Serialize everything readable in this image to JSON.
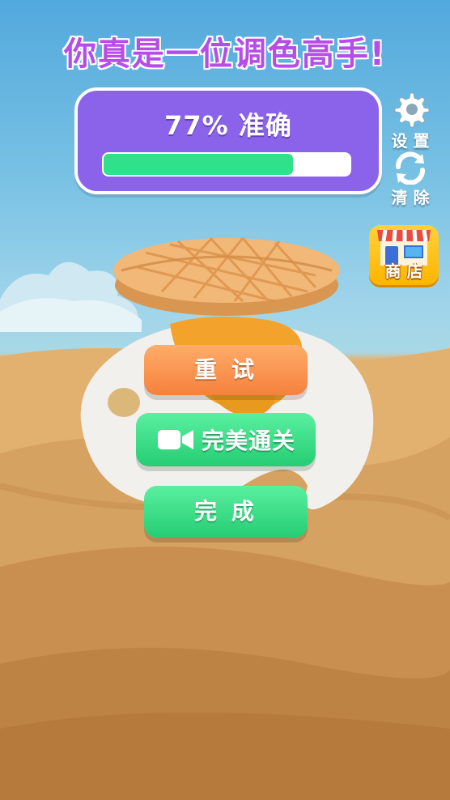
{
  "title": "你真是一位调色高手!",
  "accuracy": {
    "label": "77% 准确",
    "value": 0.77
  },
  "sidebar": {
    "settings": "设 置",
    "clear": "清 除",
    "shop": "商 店"
  },
  "buttons": {
    "retry": "重 试",
    "perfect": "完美通关",
    "done": "完 成"
  },
  "colors": {
    "title": "#b64de6",
    "panel": "#8a63ea",
    "progress": "#2fe18a",
    "retry": "#f5813c",
    "green": "#25cd73"
  }
}
